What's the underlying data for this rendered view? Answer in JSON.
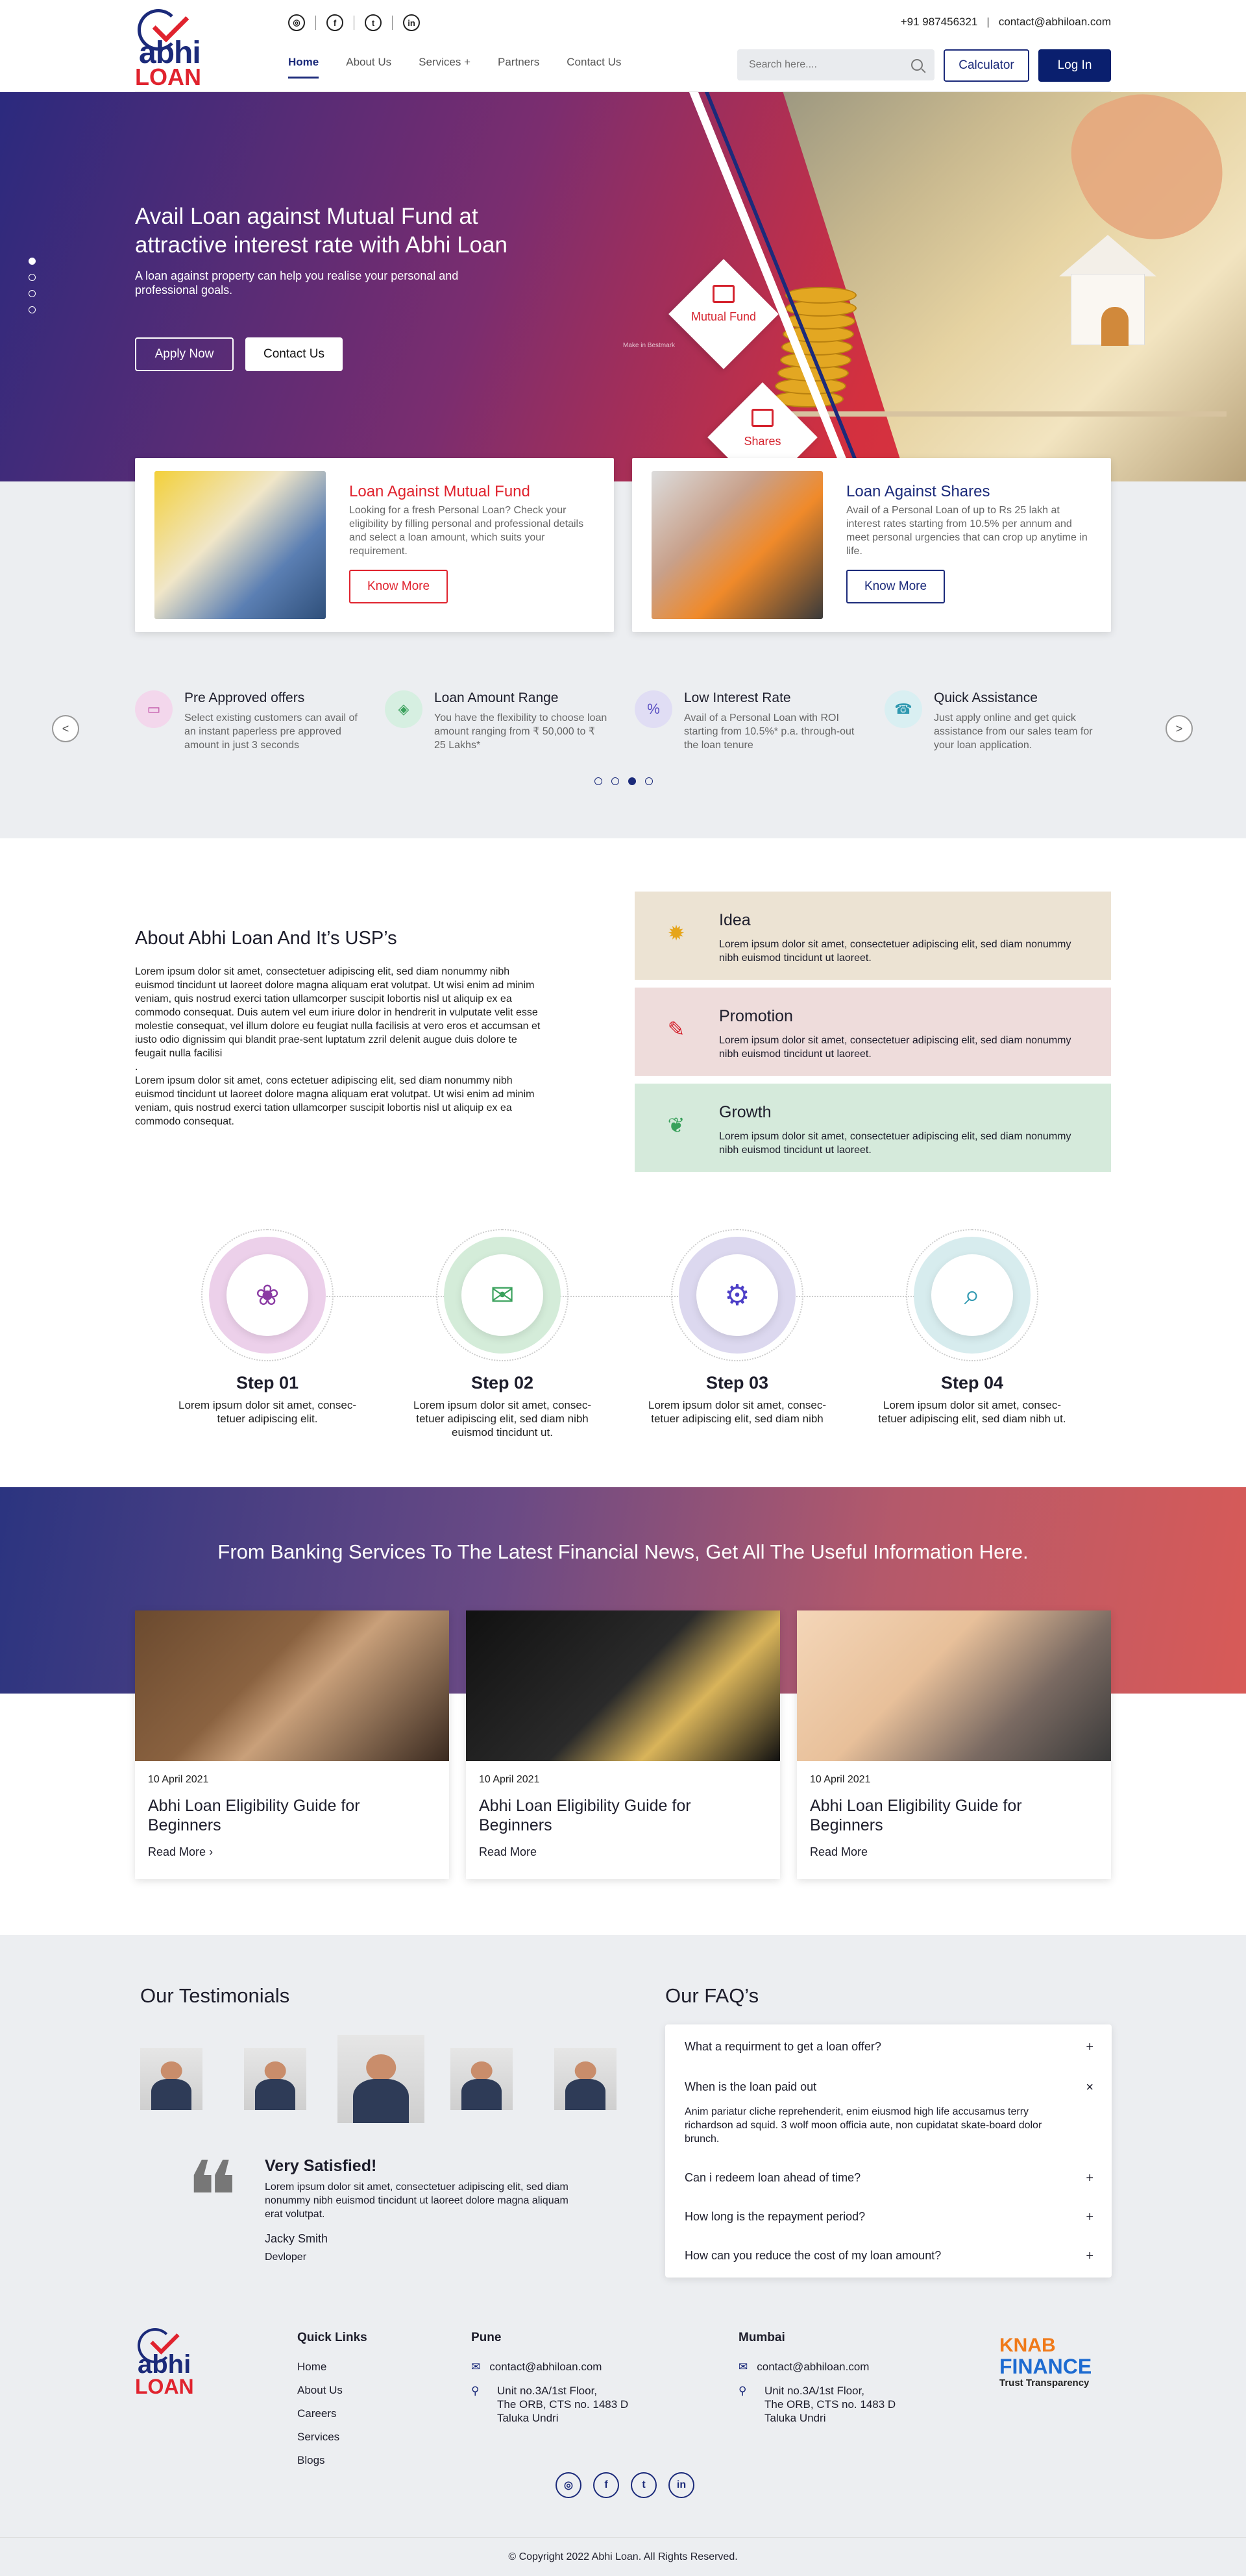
{
  "header": {
    "logo_small": "abhi",
    "logo_big": "LOAN",
    "phone": "+91 987456321",
    "separator": "|",
    "email": "contact@abhiloan.com",
    "nav": [
      "Home",
      "About Us",
      "Services +",
      "Partners",
      "Contact Us"
    ],
    "search_placeholder": "Search here....",
    "calculator_label": "Calculator",
    "login_label": "Log In",
    "social_icons": [
      "instagram-icon",
      "facebook-icon",
      "twitter-icon",
      "linkedin-icon"
    ]
  },
  "hero": {
    "title": "Avail Loan against Mutual Fund at attractive interest rate with Abhi Loan",
    "subtitle": "A loan against property can help you realise your personal and professional goals.",
    "apply_label": "Apply Now",
    "contact_label": "Contact Us",
    "diamond_1": "Mutual Fund",
    "diamond_2": "Shares",
    "tiny_caption": "Make in Bestmark"
  },
  "loans": [
    {
      "title": "Loan Against Mutual Fund",
      "desc": "Looking for a fresh Personal Loan? Check your eligibility by filling personal and professional details and select a loan amount, which suits your requirement.",
      "button": "Know More",
      "color": "#e0232e"
    },
    {
      "title": "Loan Against Shares",
      "desc": "Avail of a Personal Loan of up to Rs 25 lakh at interest rates starting from 10.5% per annum and meet personal urgencies that can crop up anytime in life.",
      "button": "Know More",
      "color": "#1b2a7a"
    }
  ],
  "features": [
    {
      "title": "Pre Approved offers",
      "desc": "Select existing customers can avail of an instant paperless pre approved amount in just 3 seconds",
      "icon": "laptop-icon",
      "bg": "#f3d7ec"
    },
    {
      "title": "Loan Amount Range",
      "desc": "You have the flexibility to choose loan amount ranging from ₹ 50,000 to ₹ 25 Lakhs*",
      "icon": "coin-icon",
      "bg": "#d6efe1"
    },
    {
      "title": "Low Interest Rate",
      "desc": "Avail of a Personal Loan with ROI starting from 10.5%* p.a. through-out the loan tenure",
      "icon": "rate-icon",
      "bg": "#e0ddf4"
    },
    {
      "title": "Quick Assistance",
      "desc": "Just apply online and get quick assistance from our sales team for your loan application.",
      "icon": "assistance-icon",
      "bg": "#d9eff2"
    }
  ],
  "slider": {
    "prev": "<",
    "next": ">"
  },
  "about": {
    "title": "About Abhi Loan And It’s USP’s",
    "para1": "Lorem ipsum dolor sit amet, consectetuer adipiscing elit, sed diam nonummy nibh euismod tincidunt ut laoreet dolore magna aliquam erat volutpat. Ut wisi enim ad minim veniam, quis nostrud exerci tation ullamcorper suscipit lobortis nisl ut aliquip ex ea commodo consequat. Duis autem vel eum iriure dolor in hendrerit in vulputate velit esse molestie consequat, vel illum dolore eu feugiat nulla facilisis at vero eros et accumsan et iusto odio dignissim qui blandit prae-sent luptatum zzril delenit augue duis dolore te feugait nulla facilisi",
    "para1_end": ".",
    "para2": "Lorem ipsum dolor sit amet, cons ectetuer adipiscing elit, sed diam nonummy nibh euismod tincidunt ut laoreet dolore magna aliquam erat volutpat. Ut wisi enim ad minim veniam, quis nostrud exerci tation ullamcorper suscipit lobortis nisl ut aliquip ex ea commodo consequat.",
    "usps": [
      {
        "title": "Idea",
        "text": "Lorem ipsum dolor sit amet, consectetuer adipiscing elit, sed diam nonummy nibh euismod tincidunt ut laoreet.",
        "bg": "#ece3d3",
        "icon": "bulb-icon"
      },
      {
        "title": "Promotion",
        "text": "Lorem ipsum dolor sit amet, consectetuer adipiscing elit, sed diam nonummy nibh euismod tincidunt ut laoreet.",
        "bg": "#eedcdb",
        "icon": "megaphone-icon"
      },
      {
        "title": "Growth",
        "text": "Lorem ipsum dolor sit amet, consectetuer adipiscing elit, sed diam nonummy nibh euismod tincidunt ut laoreet.",
        "bg": "#d5eadb",
        "icon": "plant-icon"
      }
    ]
  },
  "steps": [
    {
      "title": "Step 01",
      "text": "Lorem ipsum dolor sit amet, consec-tetuer adipiscing elit.",
      "icon": "bulb-icon",
      "glyph": "❀",
      "ring": "#ecd0ea",
      "color": "#8a3aa3"
    },
    {
      "title": "Step 02",
      "text": "Lorem ipsum dolor sit amet, consec-tetuer adipiscing elit, sed diam nibh euismod tincidunt ut.",
      "icon": "mail-icon",
      "glyph": "✉",
      "ring": "#d4ecd9",
      "color": "#3aa15c"
    },
    {
      "title": "Step 03",
      "text": "Lorem ipsum dolor sit amet, consec-tetuer adipiscing elit, sed diam nibh",
      "icon": "gear-icon",
      "glyph": "⚙",
      "ring": "#dcd8ef",
      "color": "#4d3fc7"
    },
    {
      "title": "Step 04",
      "text": "Lorem ipsum dolor sit amet, consec-tetuer adipiscing elit, sed diam nibh ut.",
      "icon": "search-icon",
      "glyph": "⌕",
      "ring": "#d7ecee",
      "color": "#2e98b0"
    }
  ],
  "news": {
    "heading": "From Banking Services To The Latest Financial News, Get All The Useful Information Here.",
    "cards": [
      {
        "date": "10 April 2021",
        "title": "Abhi Loan Eligibility Guide for Beginners",
        "link": "Read More",
        "arrow": "›"
      },
      {
        "date": "10 April 2021",
        "title": "Abhi Loan Eligibility Guide for Beginners",
        "link": "Read More",
        "arrow": ""
      },
      {
        "date": "10 April 2021",
        "title": "Abhi Loan Eligibility Guide for Beginners",
        "link": "Read More",
        "arrow": ""
      }
    ]
  },
  "testimonials": {
    "heading": "Our Testimonials",
    "quote_title": "Very Satisfied!",
    "quote_text": "Lorem ipsum dolor sit amet, consectetuer adipiscing elit, sed diam nonummy nibh euismod tincidunt ut laoreet dolore magna aliquam erat volutpat.",
    "name": "Jacky Smith",
    "role": "Devloper"
  },
  "faq": {
    "heading": "Our FAQ’s",
    "items": [
      {
        "q": "What a requirment to get a loan offer?",
        "sign": "+"
      },
      {
        "q": "When is the loan paid out",
        "sign": "×"
      },
      {
        "q": "Can i redeem loan ahead of time?",
        "sign": "+"
      },
      {
        "q": "How long is the repayment period?",
        "sign": "+"
      },
      {
        "q": "How can you reduce the cost of my loan amount?",
        "sign": "+"
      }
    ],
    "answer": "Anim pariatur cliche reprehenderit, enim eiusmod high life accusamus terry richardson ad squid. 3 wolf moon officia aute, non cupidatat skate-board dolor brunch."
  },
  "footer": {
    "quick_links_title": "Quick Links",
    "quick_links": [
      "Home",
      "About Us",
      "Careers",
      "Services",
      "Blogs"
    ],
    "pune": {
      "title": "Pune",
      "email": "contact@abhiloan.com",
      "address": [
        "Unit no.3A/1st Floor,",
        "The ORB, CTS no. 1483 D",
        "Taluka Undri"
      ]
    },
    "mumbai": {
      "title": "Mumbai",
      "email": "contact@abhiloan.com",
      "address": [
        "Unit no.3A/1st Floor,",
        "The ORB, CTS no. 1483 D",
        "Taluka Undri"
      ]
    },
    "partner": {
      "line1": "KNAB",
      "line2": "FINANCE",
      "line3": "Trust Transparency"
    },
    "copyright": "© Copyright 2022 Abhi Loan. All Rights Reserved."
  }
}
